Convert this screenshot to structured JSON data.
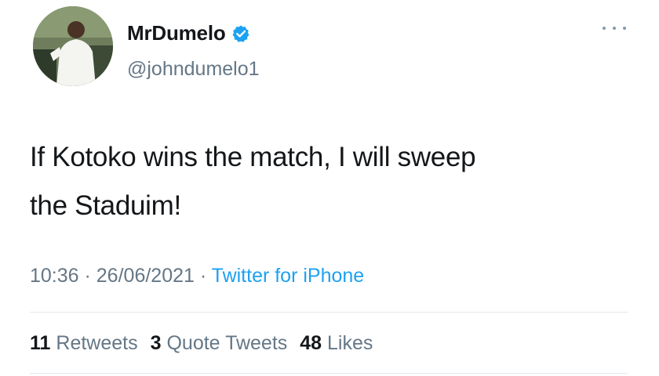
{
  "tweet": {
    "display_name": "MrDumelo",
    "handle": "@johndumelo1",
    "verified_icon": "verified-badge-icon",
    "more_icon": "more-options-icon",
    "text_line1": "If Kotoko wins the match, I will sweep",
    "text_line2": "the Staduim!",
    "time": "10:36",
    "date": "26/06/2021",
    "separator": " · ",
    "source": "Twitter for iPhone",
    "retweets_count": "11",
    "retweets_label": "Retweets",
    "quotes_count": "3",
    "quotes_label": "Quote Tweets",
    "likes_count": "48",
    "likes_label": "Likes"
  },
  "colors": {
    "verified": "#1da1f2",
    "link": "#1da1f2",
    "secondary_text": "#657786",
    "primary_text": "#14171a"
  }
}
